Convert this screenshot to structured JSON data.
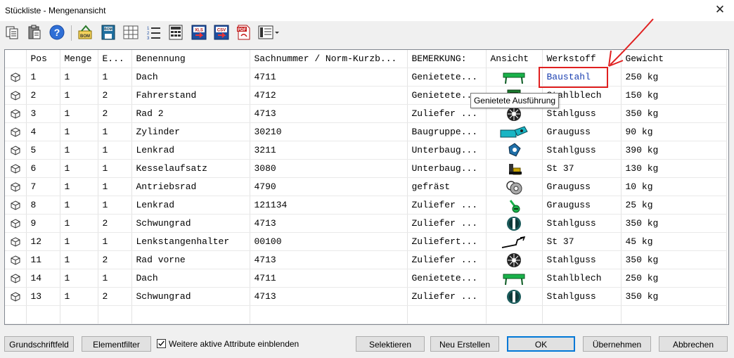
{
  "window": {
    "title": "Stückliste - Mengenansicht",
    "close": "✕"
  },
  "toolbar": {
    "icons": [
      "copy-icon",
      "paste-icon",
      "help-icon",
      "bom-export-icon",
      "bom-save-icon",
      "table-view-icon",
      "numbered-list-icon",
      "calculator-sheet-icon",
      "export-xls-icon",
      "export-csv-icon",
      "export-pdf-icon",
      "column-settings-dropdown-icon"
    ],
    "labels": {
      "bom": "BOM",
      "xls": "XLS",
      "csv": "CSV",
      "pdf": "PDF"
    }
  },
  "table": {
    "columns": [
      "",
      "Pos",
      "Menge",
      "E...",
      "Benennung",
      "Sachnummer / Norm-Kurzb...",
      "BEMERKUNG:",
      "Ansicht",
      "Werkstoff",
      "Gewicht"
    ],
    "rows": [
      {
        "pos": "1",
        "menge": "1",
        "e": "1",
        "benennung": "Dach",
        "sachnummer": "4711",
        "bemerkung": "Genietete...",
        "thumb": "dach",
        "werkstoff": "Baustahl",
        "gewicht": "250 kg"
      },
      {
        "pos": "2",
        "menge": "1",
        "e": "2",
        "benennung": "Fahrerstand",
        "sachnummer": "4712",
        "bemerkung": "Genietete...",
        "thumb": "cabin",
        "werkstoff": "Stahlblech",
        "gewicht": "150 kg"
      },
      {
        "pos": "3",
        "menge": "1",
        "e": "2",
        "benennung": "Rad 2",
        "sachnummer": "4713",
        "bemerkung": "Zuliefer ...",
        "thumb": "wheel",
        "werkstoff": "Stahlguss",
        "gewicht": "350 kg"
      },
      {
        "pos": "4",
        "menge": "1",
        "e": "1",
        "benennung": "Zylinder",
        "sachnummer": "30210",
        "bemerkung": "Baugruppe...",
        "thumb": "cylinder",
        "werkstoff": "Grauguss",
        "gewicht": "90 kg"
      },
      {
        "pos": "5",
        "menge": "1",
        "e": "1",
        "benennung": "Lenkrad",
        "sachnummer": "3211",
        "bemerkung": "Unterbaug...",
        "thumb": "steer",
        "werkstoff": "Stahlguss",
        "gewicht": "390 kg"
      },
      {
        "pos": "6",
        "menge": "1",
        "e": "1",
        "benennung": "Kesselaufsatz",
        "sachnummer": "3080",
        "bemerkung": "Unterbaug...",
        "thumb": "boiler",
        "werkstoff": "St 37",
        "gewicht": "130 kg"
      },
      {
        "pos": "7",
        "menge": "1",
        "e": "1",
        "benennung": "Antriebsrad",
        "sachnummer": "4790",
        "bemerkung": "gefräst",
        "thumb": "gear",
        "werkstoff": "Grauguss",
        "gewicht": "10 kg"
      },
      {
        "pos": "8",
        "menge": "1",
        "e": "1",
        "benennung": "Lenkrad",
        "sachnummer": "121134",
        "bemerkung": "Zuliefer ...",
        "thumb": "lever",
        "werkstoff": "Grauguss",
        "gewicht": "25 kg"
      },
      {
        "pos": "9",
        "menge": "1",
        "e": "2",
        "benennung": "Schwungrad",
        "sachnummer": "4713",
        "bemerkung": "Zuliefer ...",
        "thumb": "flywheel",
        "werkstoff": "Stahlguss",
        "gewicht": "350 kg"
      },
      {
        "pos": "12",
        "menge": "1",
        "e": "1",
        "benennung": "Lenkstangenhalter",
        "sachnummer": "00100",
        "bemerkung": "Zuliefert...",
        "thumb": "rod",
        "werkstoff": "St 37",
        "gewicht": "45 kg"
      },
      {
        "pos": "11",
        "menge": "1",
        "e": "2",
        "benennung": "Rad vorne",
        "sachnummer": "4713",
        "bemerkung": "Zuliefer ...",
        "thumb": "wheel",
        "werkstoff": "Stahlguss",
        "gewicht": "350 kg"
      },
      {
        "pos": "14",
        "menge": "1",
        "e": "1",
        "benennung": "Dach",
        "sachnummer": "4711",
        "bemerkung": "Genietete...",
        "thumb": "dach",
        "werkstoff": "Stahlblech",
        "gewicht": "250 kg"
      },
      {
        "pos": "13",
        "menge": "1",
        "e": "2",
        "benennung": "Schwungrad",
        "sachnummer": "4713",
        "bemerkung": "Zuliefer ...",
        "thumb": "flywheel",
        "werkstoff": "Stahlguss",
        "gewicht": "350 kg"
      }
    ],
    "highlight_color": "#e02020",
    "link_color": "#1a3fb0"
  },
  "tooltip": {
    "text": "Genietete Ausführung"
  },
  "footer": {
    "grundschriftfeld": "Grundschriftfeld",
    "elementfilter": "Elementfilter",
    "checkbox_label": "Weitere aktive Attribute einblenden",
    "checkbox_checked": true,
    "selektieren": "Selektieren",
    "neu_erstellen": "Neu Erstellen",
    "ok": "OK",
    "uebernehmen": "Übernehmen",
    "abbrechen": "Abbrechen"
  }
}
